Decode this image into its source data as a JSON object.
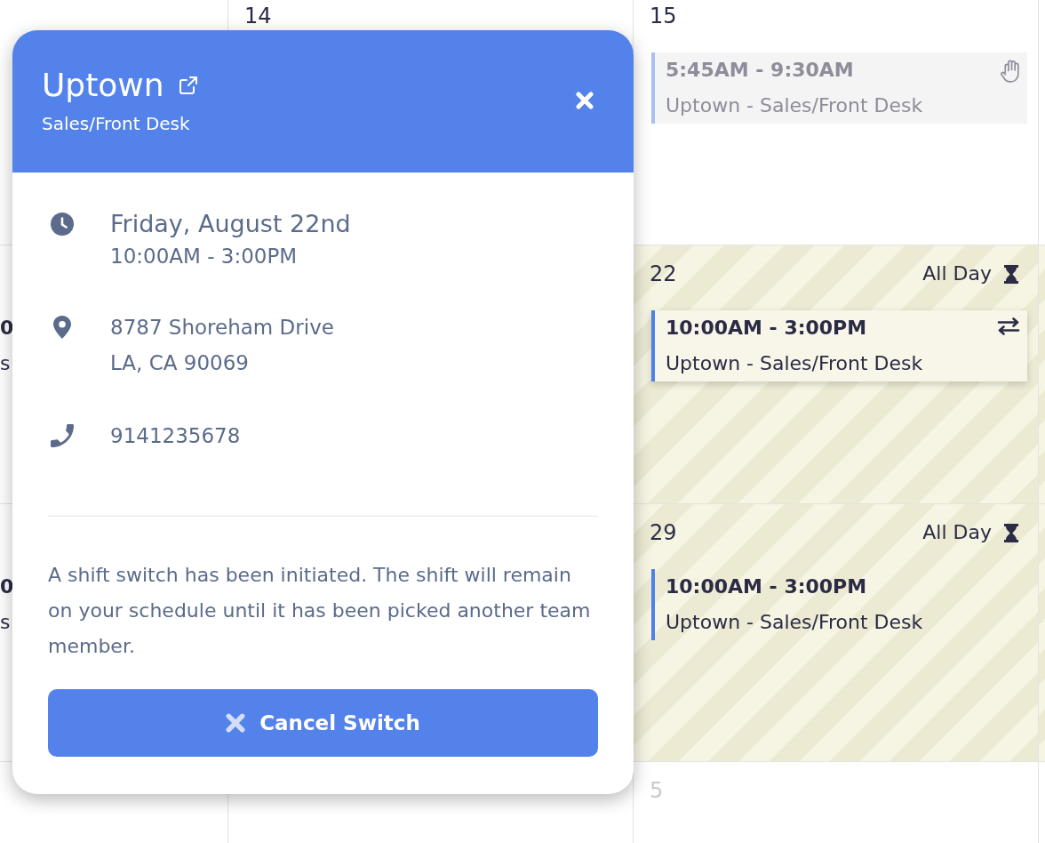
{
  "calendar": {
    "weeks": [
      {
        "days": [
          {
            "date": "14",
            "highlighted": false,
            "other_month": false
          },
          {
            "date": "15",
            "highlighted": false,
            "other_month": false,
            "events": [
              {
                "kind": "pickup",
                "time": "5:45AM - 9:30AM",
                "title": "Uptown - Sales/Front Desk"
              }
            ]
          }
        ]
      },
      {
        "edge_event": {
          "time": "0",
          "title": "s"
        },
        "days": [
          {
            "date": "22",
            "highlighted": true,
            "other_month": false,
            "all_day": "All Day",
            "events": [
              {
                "kind": "switch",
                "time": "10:00AM - 3:00PM",
                "title": "Uptown - Sales/Front Desk"
              }
            ]
          }
        ]
      },
      {
        "edge_event": {
          "time": "0",
          "title": "s"
        },
        "days": [
          {
            "date": "29",
            "highlighted": true,
            "other_month": false,
            "all_day": "All Day",
            "events": [
              {
                "kind": "standard",
                "time": "10:00AM - 3:00PM",
                "title": "Uptown - Sales/Front Desk"
              }
            ]
          }
        ]
      },
      {
        "days": [
          {
            "date": "5",
            "highlighted": false,
            "other_month": true
          }
        ]
      }
    ]
  },
  "popup": {
    "title": "Uptown",
    "subtitle": "Sales/Front Desk",
    "details": [
      {
        "kind": "time",
        "lines": [
          "Friday, August 22nd",
          "10:00AM - 3:00PM"
        ]
      },
      {
        "kind": "location",
        "lines": [
          "8787 Shoreham Drive",
          "LA, CA 90069"
        ]
      },
      {
        "kind": "phone",
        "lines": [
          "9141235678"
        ]
      }
    ],
    "message": "A shift switch has been initiated. The shift will remain on your schedule until it has been picked another team member.",
    "button": "Cancel Switch"
  }
}
